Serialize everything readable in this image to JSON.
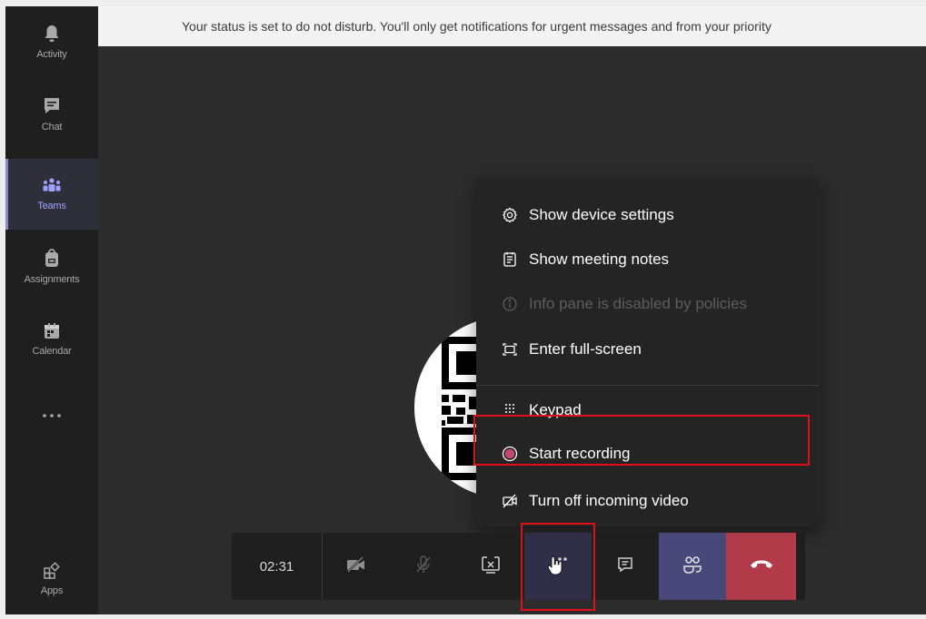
{
  "rail": {
    "items": [
      {
        "label": "Activity",
        "icon": "bell-icon"
      },
      {
        "label": "Chat",
        "icon": "chat-icon"
      },
      {
        "label": "Teams",
        "icon": "teams-icon"
      },
      {
        "label": "Assignments",
        "icon": "backpack-icon"
      },
      {
        "label": "Calendar",
        "icon": "calendar-icon"
      },
      {
        "label": "",
        "icon": "more-dots-icon"
      }
    ],
    "apps_label": "Apps",
    "active_index": 2
  },
  "banner": {
    "text": "Your status is set to do not disturb. You'll only get notifications for urgent messages and from your priority"
  },
  "menu": {
    "items": [
      {
        "label": "Show device settings",
        "icon": "gear-icon",
        "enabled": true
      },
      {
        "label": "Show meeting notes",
        "icon": "notes-icon",
        "enabled": true
      },
      {
        "label": "Info pane is disabled by policies",
        "icon": "info-icon",
        "enabled": false
      },
      {
        "label": "Enter full-screen",
        "icon": "fullscreen-icon",
        "enabled": true
      },
      {
        "label": "Keypad",
        "icon": "keypad-icon",
        "enabled": true
      },
      {
        "label": "Start recording",
        "icon": "record-icon",
        "enabled": true
      },
      {
        "label": "Turn off incoming video",
        "icon": "video-off-icon",
        "enabled": true
      }
    ]
  },
  "callbar": {
    "timer": "02:31",
    "buttons": [
      "camera-off-icon",
      "mic-off-icon",
      "stop-share-icon",
      "more-actions-icon",
      "chat-icon",
      "participants-icon",
      "hang-up-icon"
    ]
  },
  "colors": {
    "accent": "#8b8cc7",
    "hangup": "#b13b49",
    "record": "#c24a6e",
    "highlight": "#e0101a"
  }
}
